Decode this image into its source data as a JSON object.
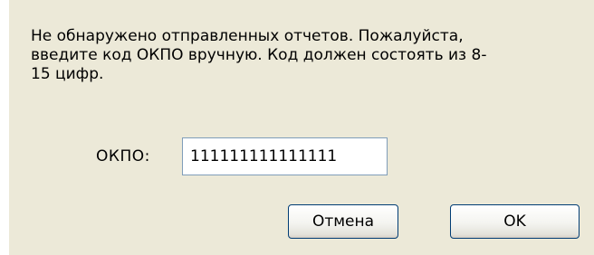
{
  "dialog": {
    "message_lines": [
      "Не обнаружено отправленных отчетов. Пожалуйста,",
      "введите код ОКПО  вручную. Код должен  состоять из 8-",
      "15 цифр."
    ],
    "okpo_label": "ОКПО:",
    "okpo_value": "111111111111111",
    "cancel_label": "Отмена",
    "ok_label": "OK"
  },
  "colors": {
    "dialog_background": "#ece9d8",
    "button_border": "#003c74",
    "input_border": "#7f9db9"
  }
}
